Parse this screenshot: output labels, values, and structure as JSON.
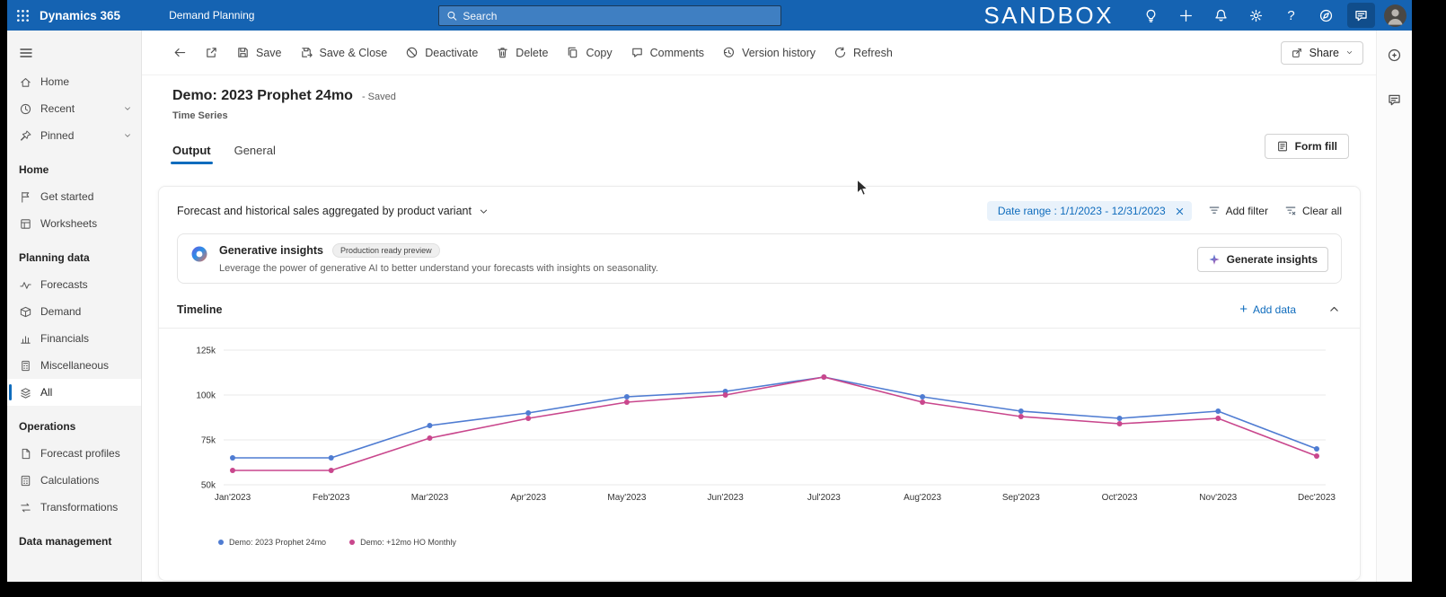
{
  "topbar": {
    "brand": "Dynamics 365",
    "app_name": "Demand Planning",
    "search_placeholder": "Search",
    "environment_label": "SANDBOX"
  },
  "sidebar": {
    "sections": [
      {
        "items": [
          {
            "label": "Home"
          },
          {
            "label": "Recent",
            "expandable": true
          },
          {
            "label": "Pinned",
            "expandable": true
          }
        ]
      },
      {
        "header": "Home",
        "items": [
          {
            "label": "Get started"
          },
          {
            "label": "Worksheets"
          }
        ]
      },
      {
        "header": "Planning data",
        "items": [
          {
            "label": "Forecasts"
          },
          {
            "label": "Demand"
          },
          {
            "label": "Financials"
          },
          {
            "label": "Miscellaneous"
          },
          {
            "label": "All",
            "selected": true
          }
        ]
      },
      {
        "header": "Operations",
        "items": [
          {
            "label": "Forecast profiles"
          },
          {
            "label": "Calculations"
          },
          {
            "label": "Transformations"
          }
        ]
      },
      {
        "header": "Data management",
        "items": []
      }
    ]
  },
  "command_bar": {
    "items": [
      {
        "label": "Save"
      },
      {
        "label": "Save & Close"
      },
      {
        "label": "Deactivate"
      },
      {
        "label": "Delete"
      },
      {
        "label": "Copy"
      },
      {
        "label": "Comments"
      },
      {
        "label": "Version history"
      },
      {
        "label": "Refresh"
      }
    ],
    "share_label": "Share"
  },
  "record": {
    "title": "Demo: 2023 Prophet 24mo",
    "saved_status": "- Saved",
    "entity": "Time Series"
  },
  "tabs": [
    {
      "label": "Output",
      "active": true
    },
    {
      "label": "General",
      "active": false
    }
  ],
  "form_fill_label": "Form fill",
  "filter_bar": {
    "view_selector": "Forecast and historical sales aggregated by product variant",
    "date_range_pill": "Date range : 1/1/2023 - 12/31/2023",
    "add_filter_label": "Add filter",
    "clear_all_label": "Clear all"
  },
  "generative_insights": {
    "title": "Generative insights",
    "badge": "Production ready preview",
    "description": "Leverage the power of generative AI to better understand your forecasts with insights on seasonality.",
    "cta_label": "Generate insights"
  },
  "timeline": {
    "title": "Timeline",
    "add_data_label": "Add data"
  },
  "chart_data": {
    "type": "line",
    "categories": [
      "Jan'2023",
      "Feb'2023",
      "Mar'2023",
      "Apr'2023",
      "May'2023",
      "Jun'2023",
      "Jul'2023",
      "Aug'2023",
      "Sep'2023",
      "Oct'2023",
      "Nov'2023",
      "Dec'2023"
    ],
    "series": [
      {
        "name": "Demo: 2023 Prophet 24mo",
        "color": "#4f7cd2",
        "values": [
          65000,
          65000,
          83000,
          90000,
          99000,
          102000,
          110000,
          99000,
          91000,
          87000,
          91000,
          70000
        ]
      },
      {
        "name": "Demo: +12mo HO Monthly",
        "color": "#c9478d",
        "values": [
          58000,
          58000,
          76000,
          87000,
          96000,
          100000,
          110000,
          96000,
          88000,
          84000,
          87000,
          66000
        ]
      }
    ],
    "ylim": [
      50000,
      127000
    ],
    "yticks": [
      {
        "value": 50000,
        "label": "50k"
      },
      {
        "value": 75000,
        "label": "75k"
      },
      {
        "value": 100000,
        "label": "100k"
      },
      {
        "value": 125000,
        "label": "125k"
      }
    ],
    "grid": true,
    "legend_position": "bottom-left"
  },
  "colors": {
    "topbar": "#1563b2",
    "accent": "#0f6cbd"
  }
}
